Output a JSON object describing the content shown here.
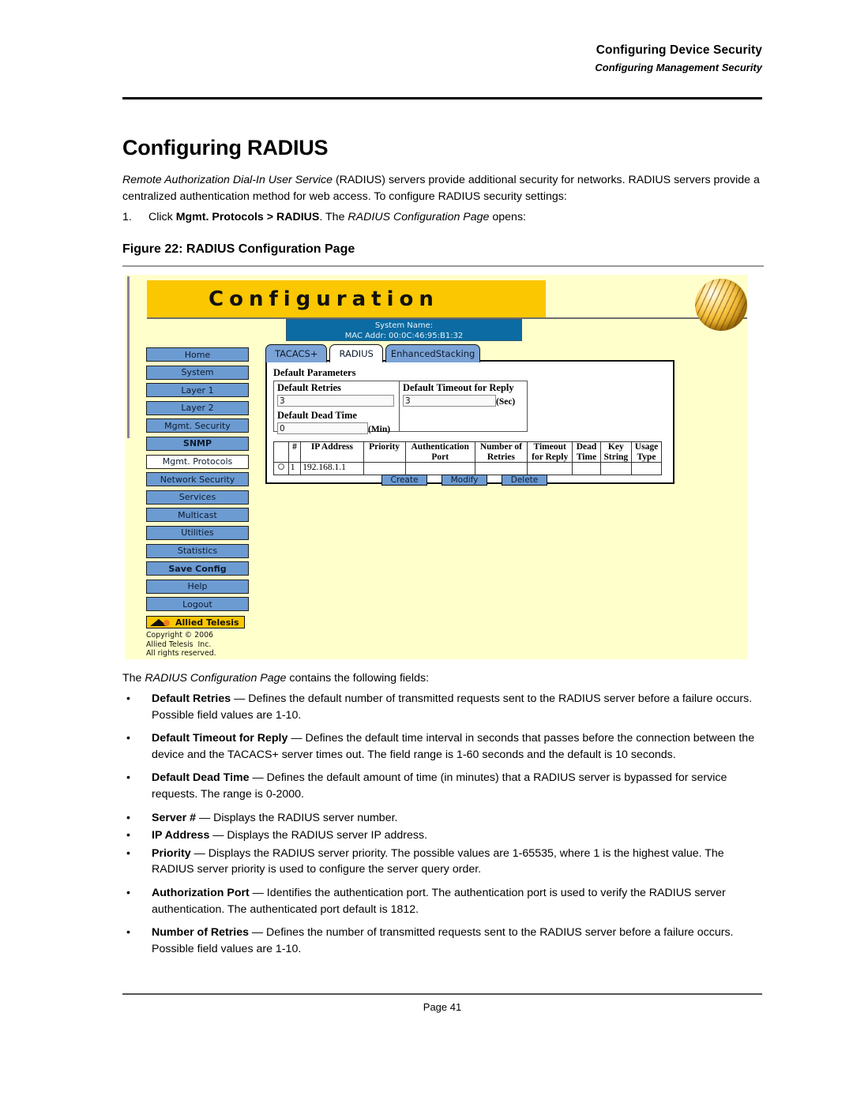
{
  "header": {
    "title": "Configuring Device Security",
    "subtitle": "Configuring Management Security"
  },
  "page_title": "Configuring RADIUS",
  "intro_html": "<i>Remote Authorization Dial-In User Service</i> (RADIUS) servers provide additional security for networks. RADIUS servers provide a centralized authentication method for web access. To configure RADIUS security settings:",
  "step": {
    "number": "1.",
    "html": "Click <b>Mgmt. Protocols &gt; RADIUS</b>. The <i>RADIUS Configuration Page</i> opens:"
  },
  "figure_caption": "Figure 22:  RADIUS Configuration Page",
  "figure": {
    "banner_title": "Configuration",
    "system_bar": {
      "name_label": "System Name:",
      "mac_label": "MAC Addr: 00:0C:46:95:B1:32"
    },
    "sidebar": [
      {
        "label": "Home",
        "style": "blue"
      },
      {
        "label": "System",
        "style": "blue"
      },
      {
        "label": "Layer 1",
        "style": "blue"
      },
      {
        "label": "Layer 2",
        "style": "blue"
      },
      {
        "label": "Mgmt. Security",
        "style": "blue"
      },
      {
        "label": "SNMP",
        "style": "blue-bold"
      },
      {
        "label": "Mgmt. Protocols",
        "style": "white"
      },
      {
        "label": "Network Security",
        "style": "blue"
      },
      {
        "label": "Services",
        "style": "blue"
      },
      {
        "label": "Multicast",
        "style": "blue"
      },
      {
        "label": "Utilities",
        "style": "blue"
      },
      {
        "label": "Statistics",
        "style": "blue"
      },
      {
        "label": "Save Config",
        "style": "blue-bold"
      },
      {
        "label": "Help",
        "style": "blue"
      },
      {
        "label": "Logout",
        "style": "blue"
      }
    ],
    "logo_text": "Allied Telesis",
    "copyright": "Copyright © 2006\nAllied Telesis  Inc.\nAll rights reserved.",
    "tabs": [
      {
        "label": "TACACS+",
        "active": false
      },
      {
        "label": "RADIUS",
        "active": true
      },
      {
        "label": "Enhanced\nStacking",
        "active": false
      }
    ],
    "default_parameters": {
      "section_label": "Default Parameters",
      "retries_label": "Default Retries",
      "retries_value": "3",
      "dead_time_label": "Default Dead Time",
      "dead_time_value": "0",
      "dead_time_unit": "(Min)",
      "timeout_label": "Default Timeout for Reply",
      "timeout_value": "3",
      "timeout_unit": "(Sec)"
    },
    "server_table": {
      "columns": [
        "",
        "#",
        "IP Address",
        "Priority",
        "Authentication Port",
        "Number of Retries",
        "Timeout for Reply",
        "Dead Time",
        "Key String",
        "Usage Type"
      ],
      "rows": [
        {
          "selected": false,
          "num": "1",
          "ip_address": "192.168.1.1",
          "priority": "",
          "auth_port": "",
          "retries": "",
          "timeout": "",
          "dead_time": "",
          "key_string": "",
          "usage_type": ""
        }
      ]
    },
    "buttons": [
      "Create",
      "Modify",
      "Delete"
    ]
  },
  "fields_lead_html": "The <i>RADIUS Configuration Page</i> contains the following fields:",
  "bullets": [
    {
      "html": "<b>Default Retries</b> — Defines the default number of transmitted requests sent to the RADIUS server before a failure occurs. Possible field values are 1-10.",
      "tight": false
    },
    {
      "html": "<b>Default Timeout for Reply</b> — Defines the default time interval in seconds that passes before the connection between the device and the TACACS+ server times out. The field range is 1-60 seconds and the default is 10 seconds.",
      "tight": false
    },
    {
      "html": "<b>Default Dead Time</b> — Defines the default amount of time (in minutes) that a RADIUS server is bypassed for service requests. The range is 0-2000.",
      "tight": false
    },
    {
      "html": "<b>Server #</b> — Displays the RADIUS server number.",
      "tight": true
    },
    {
      "html": "<b>IP Address</b> — Displays the RADIUS server IP address.",
      "tight": true
    },
    {
      "html": "<b>Priority</b> — Displays the RADIUS server priority. The possible values are 1-65535, where 1 is the highest value. The RADIUS server priority is used to configure the server query order.",
      "tight": false
    },
    {
      "html": "<b>Authorization Port</b> — Identifies the authentication port. The authentication port is used to verify the RADIUS server authentication. The authenticated port default is 1812.",
      "tight": false
    },
    {
      "html": "<b>Number of Retries</b> — Defines the number of transmitted requests sent to the RADIUS server before a failure occurs. Possible field values are 1-10.",
      "tight": false
    }
  ],
  "bullet_marker": "•",
  "footer": {
    "page_label": "Page 41"
  },
  "colors": {
    "banner": "#fbc700",
    "figure_background": "#ffffcc",
    "nav_button": "#6c9bd2",
    "system_bar": "#0b6ba2"
  }
}
